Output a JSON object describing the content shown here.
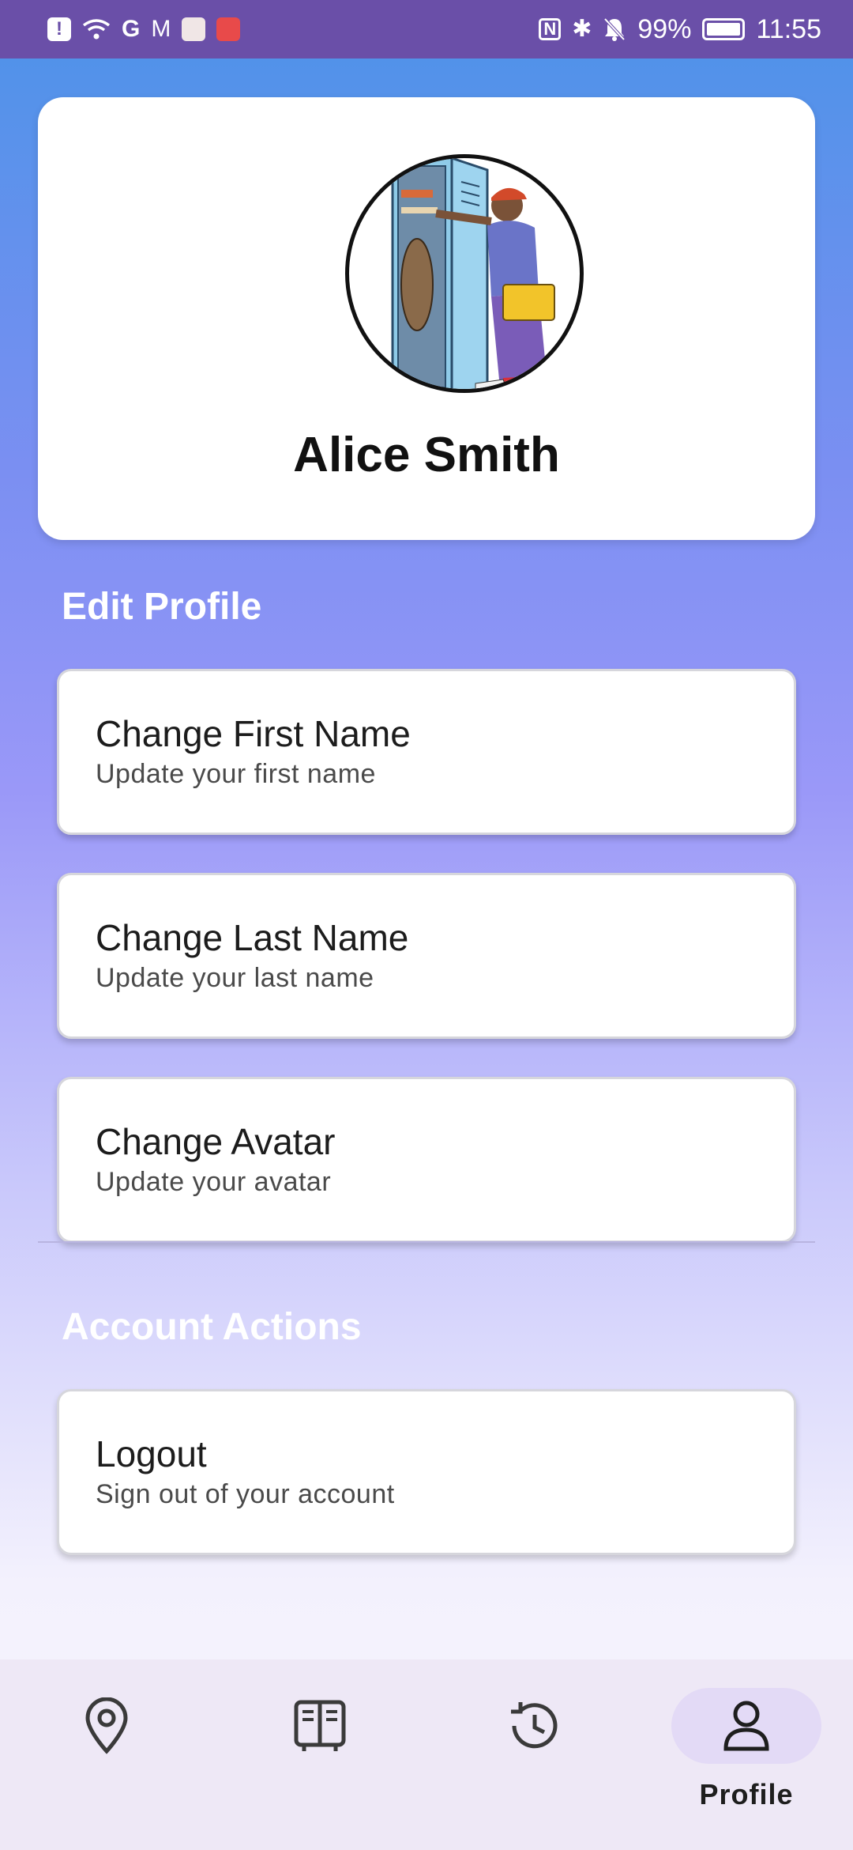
{
  "status_bar": {
    "left_icons": [
      "alert-icon",
      "wifi-icon",
      "g-icon",
      "gmail-icon",
      "app-icon",
      "huawei-icon"
    ],
    "battery": "99%",
    "time": "11:55"
  },
  "profile": {
    "name": "Alice Smith",
    "avatar": "locker-illustration"
  },
  "edit_profile": {
    "title": "Edit Profile",
    "items": [
      {
        "title": "Change First Name",
        "subtitle": "Update your first name"
      },
      {
        "title": "Change Last Name",
        "subtitle": "Update your last name"
      },
      {
        "title": "Change Avatar",
        "subtitle": "Update your avatar"
      }
    ]
  },
  "account_actions": {
    "title": "Account Actions",
    "items": [
      {
        "title": "Logout",
        "subtitle": "Sign out of your account"
      }
    ]
  },
  "bottom_nav": {
    "items": [
      {
        "icon": "map-pin-icon",
        "label": ""
      },
      {
        "icon": "lockers-icon",
        "label": ""
      },
      {
        "icon": "history-icon",
        "label": ""
      },
      {
        "icon": "person-icon",
        "label": "Profile",
        "active": true
      }
    ]
  },
  "colors": {
    "status_bar": "#6a4fa8",
    "gradient_top": "#4c93e8",
    "gradient_mid": "#9a98f8",
    "gradient_bottom": "#f7f5fc",
    "nav_background": "#eee8f6",
    "nav_active_pill": "#e3daf6"
  }
}
